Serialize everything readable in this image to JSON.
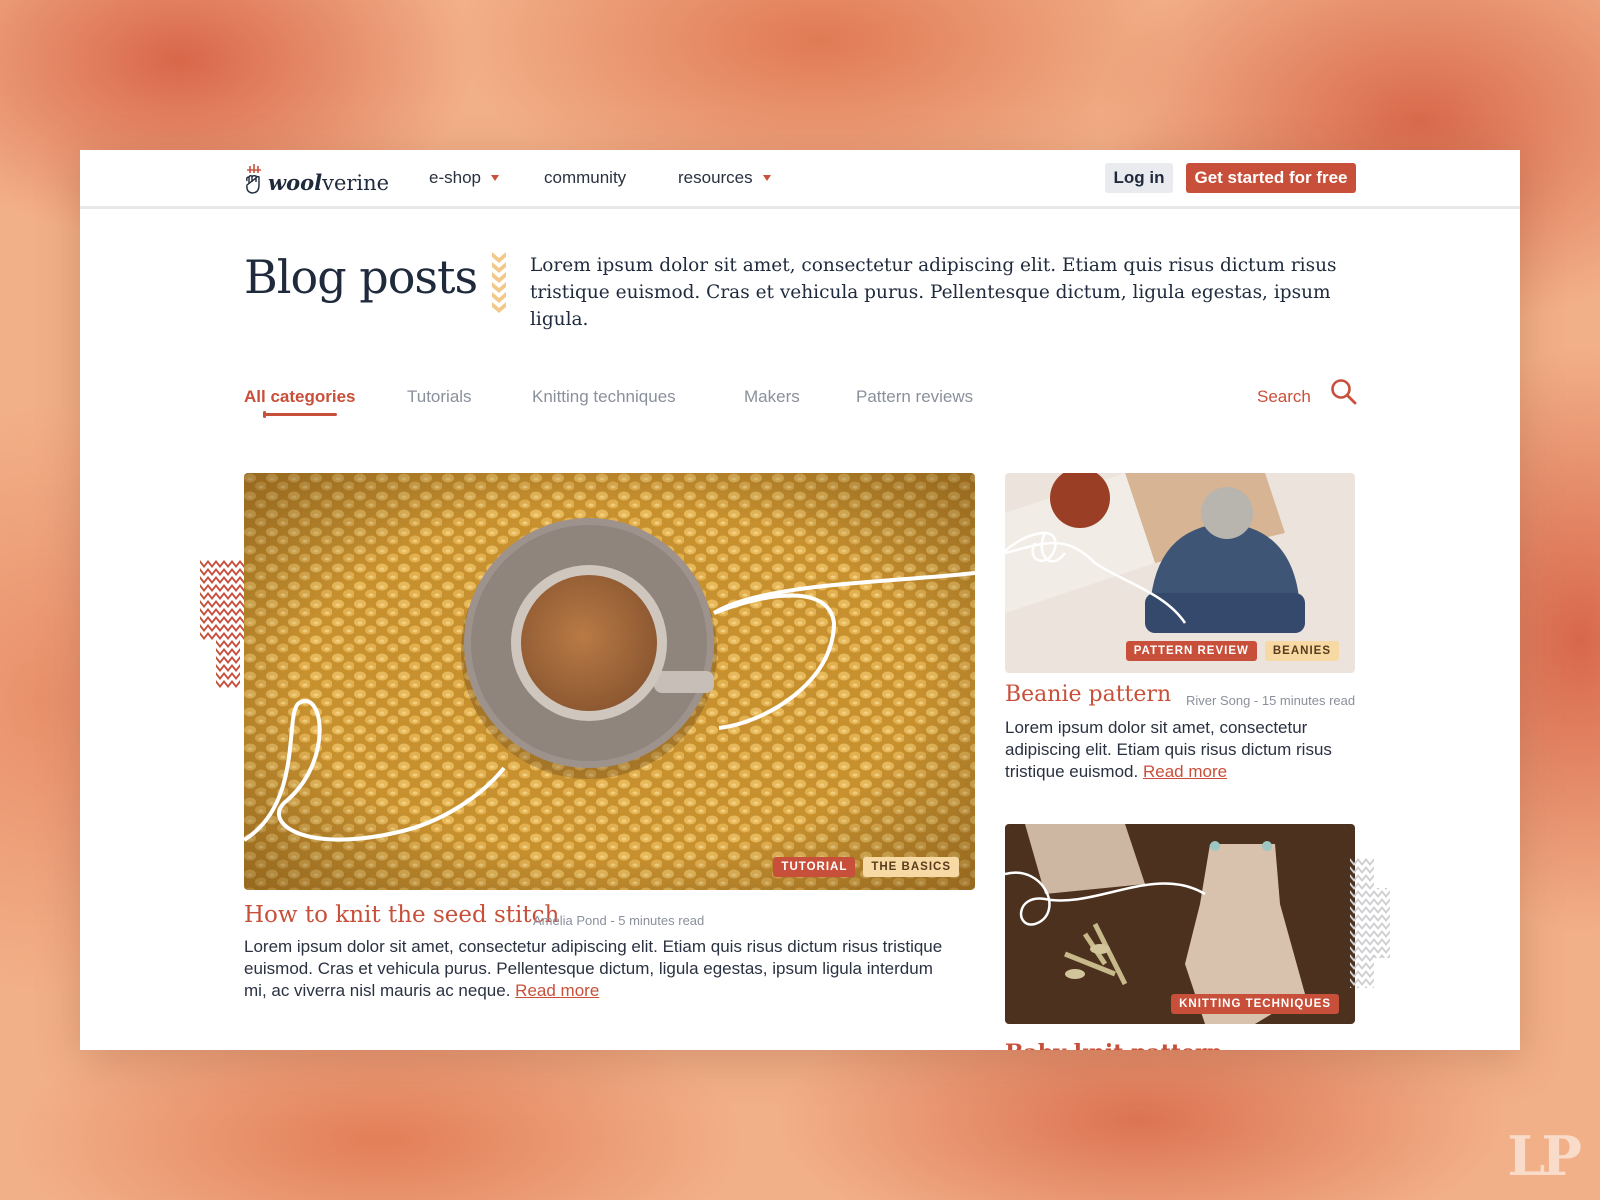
{
  "brand": {
    "logo_part1": "wool",
    "logo_part2": "verine"
  },
  "nav": {
    "items": [
      {
        "label": "e-shop",
        "has_dropdown": true
      },
      {
        "label": "community",
        "has_dropdown": false
      },
      {
        "label": "resources",
        "has_dropdown": true
      }
    ],
    "login_label": "Log in",
    "cta_label": "Get started for free"
  },
  "header": {
    "title": "Blog posts",
    "intro": "Lorem ipsum dolor sit amet, consectetur adipiscing elit. Etiam quis risus dictum risus tristique euismod. Cras et vehicula purus. Pellentesque dictum, ligula egestas, ipsum ligula."
  },
  "categories": {
    "tabs": [
      {
        "label": "All categories",
        "active": true
      },
      {
        "label": "Tutorials",
        "active": false
      },
      {
        "label": "Knitting techniques",
        "active": false
      },
      {
        "label": "Makers",
        "active": false
      },
      {
        "label": "Pattern reviews",
        "active": false
      }
    ],
    "search_label": "Search"
  },
  "posts": [
    {
      "title": "How to knit the seed stitch",
      "meta": "Amelia Pond - 5 minutes read",
      "tags": [
        "TUTORIAL",
        "THE BASICS"
      ],
      "excerpt": "Lorem ipsum dolor sit amet, consectetur adipiscing elit. Etiam quis risus dictum risus tristique euismod. Cras et vehicula purus. Pellentesque dictum, ligula egestas, ipsum ligula interdum mi, ac viverra nisl mauris ac neque.",
      "read_more": "Read more"
    },
    {
      "title": "Beanie pattern",
      "meta": "River Song - 15 minutes read",
      "tags": [
        "PATTERN REVIEW",
        "BEANIES"
      ],
      "excerpt": "Lorem ipsum dolor sit amet, consectetur adipiscing elit. Etiam quis risus dictum risus tristique euismod.",
      "read_more": "Read more"
    },
    {
      "title": "Baby knit pattern",
      "tags": [
        "KNITTING TECHNIQUES"
      ]
    }
  ],
  "colors": {
    "accent": "#c8503a",
    "cream_tag": "#f6d9a3",
    "text": "#1f2a3c",
    "muted": "#8a909b"
  },
  "watermark": "LP"
}
